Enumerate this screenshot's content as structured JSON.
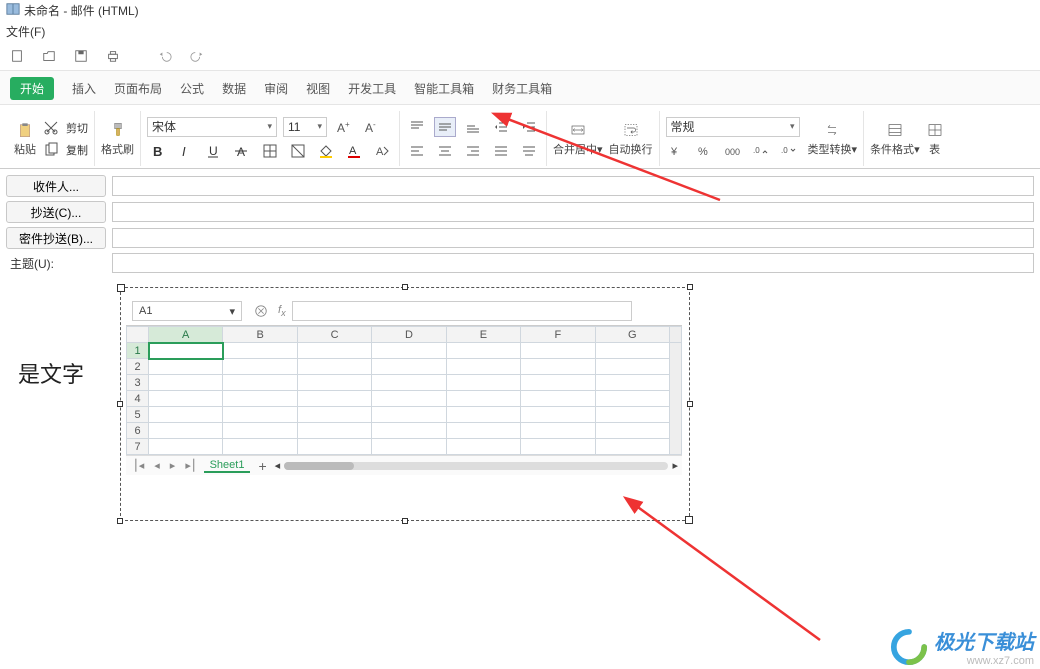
{
  "window": {
    "title": "未命名 - 邮件 (HTML)"
  },
  "menubar": {
    "file": "文件(F)"
  },
  "tabs": {
    "start": "开始",
    "insert": "插入",
    "layout": "页面布局",
    "formula": "公式",
    "data": "数据",
    "review": "审阅",
    "view": "视图",
    "devtools": "开发工具",
    "smarttools": "智能工具箱",
    "fintools": "财务工具箱"
  },
  "ribbon": {
    "paste": "粘贴",
    "cut": "剪切",
    "copy": "复制",
    "formatpainter": "格式刷",
    "font_name": "宋体",
    "font_size": "11",
    "mergecenter": "合并居中",
    "wrap": "自动换行",
    "format_general": "常规",
    "typeconvert": "类型转换",
    "condformat": "条件格式",
    "tablestyle": "表"
  },
  "mail": {
    "to": "收件人...",
    "cc": "抄送(C)...",
    "bcc": "密件抄送(B)...",
    "subject": "主题(U):"
  },
  "sidetext": "是文字",
  "sheet": {
    "namebox": "A1",
    "cols": [
      "A",
      "B",
      "C",
      "D",
      "E",
      "F",
      "G"
    ],
    "rows": [
      "1",
      "2",
      "3",
      "4",
      "5",
      "6",
      "7"
    ],
    "tab": "Sheet1"
  },
  "chart_data": {
    "type": "table",
    "columns": [
      "A",
      "B",
      "C",
      "D",
      "E",
      "F",
      "G"
    ],
    "rows": [
      [
        "",
        "",
        "",
        "",
        "",
        "",
        ""
      ],
      [
        "",
        "",
        "",
        "",
        "",
        "",
        ""
      ],
      [
        "",
        "",
        "",
        "",
        "",
        "",
        ""
      ],
      [
        "",
        "",
        "",
        "",
        "",
        "",
        ""
      ],
      [
        "",
        "",
        "",
        "",
        "",
        "",
        ""
      ],
      [
        "",
        "",
        "",
        "",
        "",
        "",
        ""
      ],
      [
        "",
        "",
        "",
        "",
        "",
        "",
        ""
      ]
    ],
    "selected_cell": "A1"
  },
  "branding": {
    "site_name": "极光下载站",
    "url": "www.xz7.com"
  }
}
